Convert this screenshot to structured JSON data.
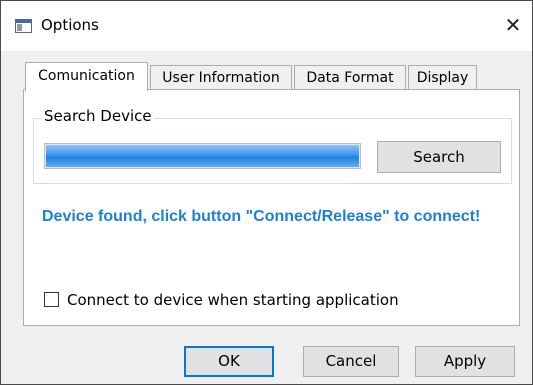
{
  "window": {
    "title": "Options",
    "icon": "app-window-icon",
    "close_glyph": "✕"
  },
  "tabs": [
    {
      "label": "Comunication",
      "active": true
    },
    {
      "label": "User Information",
      "active": false
    },
    {
      "label": "Data Format",
      "active": false
    },
    {
      "label": "Display",
      "active": false
    }
  ],
  "search_group": {
    "label": "Search Device",
    "progress_fraction": 1.0,
    "search_button": "Search"
  },
  "status_message": "Device found, click button \"Connect/Release\" to connect!",
  "autoconnect": {
    "label": "Connect to device when starting application",
    "checked": false
  },
  "buttons": {
    "ok": "OK",
    "cancel": "Cancel",
    "apply": "Apply"
  },
  "colors": {
    "status_text": "#1e7fd6",
    "progress_fill": "#2a88e8",
    "default_button_border": "#0078d7"
  }
}
